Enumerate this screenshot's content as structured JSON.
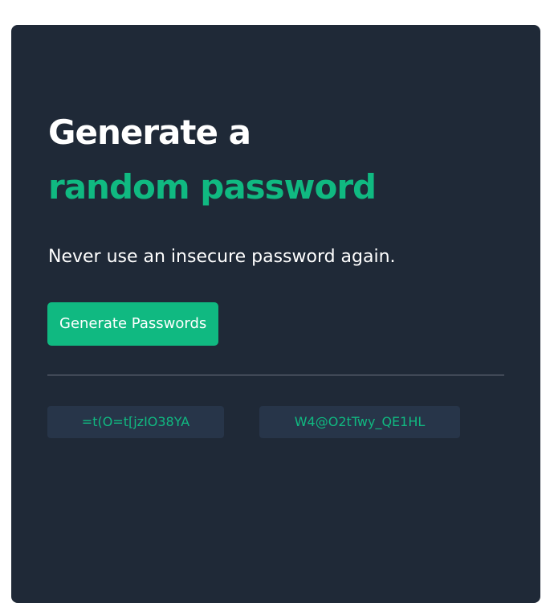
{
  "heading": {
    "line1": "Generate a",
    "line2": "random password"
  },
  "subtitle": "Never use an insecure password again.",
  "generate_button_label": "Generate Passwords",
  "passwords": [
    "=t(O=t[jzIO38YA",
    "W4@O2tTwy_QE1HL"
  ],
  "colors": {
    "card_background": "#1f2937",
    "accent": "#10b981",
    "password_box_background": "#273549",
    "divider": "#6b7280"
  }
}
